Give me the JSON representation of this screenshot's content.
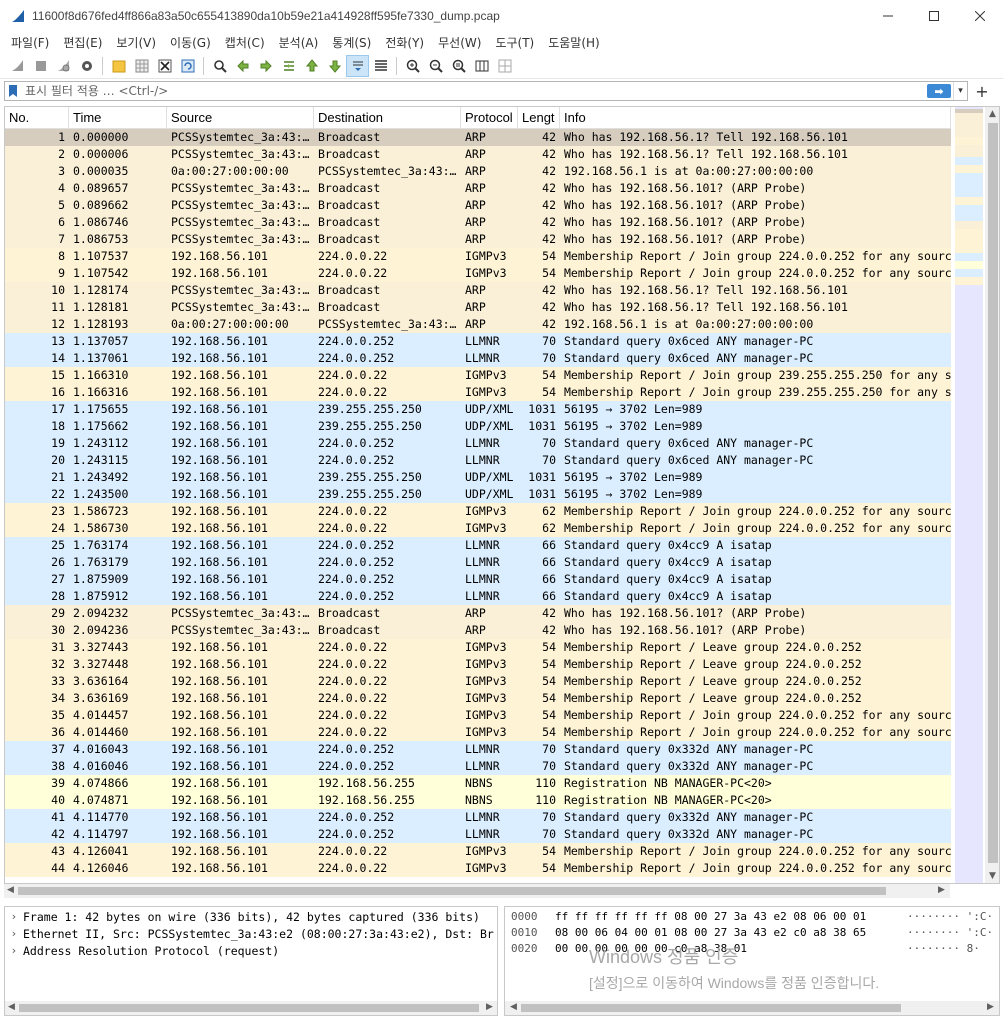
{
  "window": {
    "title": "11600f8d676fed4ff866a83a50c655413890da10b59e21a414928ff595fe7330_dump.pcap",
    "minimize": "—",
    "maximize": "☐",
    "close": "✕"
  },
  "menu": [
    "파일(F)",
    "편집(E)",
    "보기(V)",
    "이동(G)",
    "캡처(C)",
    "분석(A)",
    "통계(S)",
    "전화(Y)",
    "무선(W)",
    "도구(T)",
    "도움말(H)"
  ],
  "filter": {
    "placeholder": "표시 필터 적용 … <Ctrl-/>",
    "apply": "➡",
    "dropdown": "▾",
    "add": "+"
  },
  "columns": [
    "No.",
    "Time",
    "Source",
    "Destination",
    "Protocol",
    "Lengt",
    "Info"
  ],
  "colors": {
    "arp": "#faf0d7",
    "igmp": "#fff3d6",
    "udp": "#daeeff",
    "nbns": "#ffffda",
    "selected": "#d6cdbf"
  },
  "packets": [
    {
      "no": "1",
      "time": "0.000000",
      "src": "PCSSystemtec_3a:43:…",
      "dst": "Broadcast",
      "proto": "ARP",
      "len": "42",
      "info": "Who has 192.168.56.1? Tell 192.168.56.101",
      "kind": "arp",
      "selected": true
    },
    {
      "no": "2",
      "time": "0.000006",
      "src": "PCSSystemtec_3a:43:…",
      "dst": "Broadcast",
      "proto": "ARP",
      "len": "42",
      "info": "Who has 192.168.56.1? Tell 192.168.56.101",
      "kind": "arp"
    },
    {
      "no": "3",
      "time": "0.000035",
      "src": "0a:00:27:00:00:00",
      "dst": "PCSSystemtec_3a:43:…",
      "proto": "ARP",
      "len": "42",
      "info": "192.168.56.1 is at 0a:00:27:00:00:00",
      "kind": "arp"
    },
    {
      "no": "4",
      "time": "0.089657",
      "src": "PCSSystemtec_3a:43:…",
      "dst": "Broadcast",
      "proto": "ARP",
      "len": "42",
      "info": "Who has 192.168.56.101? (ARP Probe)",
      "kind": "arp"
    },
    {
      "no": "5",
      "time": "0.089662",
      "src": "PCSSystemtec_3a:43:…",
      "dst": "Broadcast",
      "proto": "ARP",
      "len": "42",
      "info": "Who has 192.168.56.101? (ARP Probe)",
      "kind": "arp"
    },
    {
      "no": "6",
      "time": "1.086746",
      "src": "PCSSystemtec_3a:43:…",
      "dst": "Broadcast",
      "proto": "ARP",
      "len": "42",
      "info": "Who has 192.168.56.101? (ARP Probe)",
      "kind": "arp"
    },
    {
      "no": "7",
      "time": "1.086753",
      "src": "PCSSystemtec_3a:43:…",
      "dst": "Broadcast",
      "proto": "ARP",
      "len": "42",
      "info": "Who has 192.168.56.101? (ARP Probe)",
      "kind": "arp"
    },
    {
      "no": "8",
      "time": "1.107537",
      "src": "192.168.56.101",
      "dst": "224.0.0.22",
      "proto": "IGMPv3",
      "len": "54",
      "info": "Membership Report / Join group 224.0.0.252 for any sourc",
      "kind": "igmp"
    },
    {
      "no": "9",
      "time": "1.107542",
      "src": "192.168.56.101",
      "dst": "224.0.0.22",
      "proto": "IGMPv3",
      "len": "54",
      "info": "Membership Report / Join group 224.0.0.252 for any sourc",
      "kind": "igmp"
    },
    {
      "no": "10",
      "time": "1.128174",
      "src": "PCSSystemtec_3a:43:…",
      "dst": "Broadcast",
      "proto": "ARP",
      "len": "42",
      "info": "Who has 192.168.56.1? Tell 192.168.56.101",
      "kind": "arp"
    },
    {
      "no": "11",
      "time": "1.128181",
      "src": "PCSSystemtec_3a:43:…",
      "dst": "Broadcast",
      "proto": "ARP",
      "len": "42",
      "info": "Who has 192.168.56.1? Tell 192.168.56.101",
      "kind": "arp"
    },
    {
      "no": "12",
      "time": "1.128193",
      "src": "0a:00:27:00:00:00",
      "dst": "PCSSystemtec_3a:43:…",
      "proto": "ARP",
      "len": "42",
      "info": "192.168.56.1 is at 0a:00:27:00:00:00",
      "kind": "arp"
    },
    {
      "no": "13",
      "time": "1.137057",
      "src": "192.168.56.101",
      "dst": "224.0.0.252",
      "proto": "LLMNR",
      "len": "70",
      "info": "Standard query 0x6ced ANY manager-PC",
      "kind": "udp"
    },
    {
      "no": "14",
      "time": "1.137061",
      "src": "192.168.56.101",
      "dst": "224.0.0.252",
      "proto": "LLMNR",
      "len": "70",
      "info": "Standard query 0x6ced ANY manager-PC",
      "kind": "udp"
    },
    {
      "no": "15",
      "time": "1.166310",
      "src": "192.168.56.101",
      "dst": "224.0.0.22",
      "proto": "IGMPv3",
      "len": "54",
      "info": "Membership Report / Join group 239.255.255.250 for any s",
      "kind": "igmp"
    },
    {
      "no": "16",
      "time": "1.166316",
      "src": "192.168.56.101",
      "dst": "224.0.0.22",
      "proto": "IGMPv3",
      "len": "54",
      "info": "Membership Report / Join group 239.255.255.250 for any s",
      "kind": "igmp"
    },
    {
      "no": "17",
      "time": "1.175655",
      "src": "192.168.56.101",
      "dst": "239.255.255.250",
      "proto": "UDP/XML",
      "len": "1031",
      "info": "56195 → 3702 Len=989",
      "kind": "udp"
    },
    {
      "no": "18",
      "time": "1.175662",
      "src": "192.168.56.101",
      "dst": "239.255.255.250",
      "proto": "UDP/XML",
      "len": "1031",
      "info": "56195 → 3702 Len=989",
      "kind": "udp"
    },
    {
      "no": "19",
      "time": "1.243112",
      "src": "192.168.56.101",
      "dst": "224.0.0.252",
      "proto": "LLMNR",
      "len": "70",
      "info": "Standard query 0x6ced ANY manager-PC",
      "kind": "udp"
    },
    {
      "no": "20",
      "time": "1.243115",
      "src": "192.168.56.101",
      "dst": "224.0.0.252",
      "proto": "LLMNR",
      "len": "70",
      "info": "Standard query 0x6ced ANY manager-PC",
      "kind": "udp"
    },
    {
      "no": "21",
      "time": "1.243492",
      "src": "192.168.56.101",
      "dst": "239.255.255.250",
      "proto": "UDP/XML",
      "len": "1031",
      "info": "56195 → 3702 Len=989",
      "kind": "udp"
    },
    {
      "no": "22",
      "time": "1.243500",
      "src": "192.168.56.101",
      "dst": "239.255.255.250",
      "proto": "UDP/XML",
      "len": "1031",
      "info": "56195 → 3702 Len=989",
      "kind": "udp"
    },
    {
      "no": "23",
      "time": "1.586723",
      "src": "192.168.56.101",
      "dst": "224.0.0.22",
      "proto": "IGMPv3",
      "len": "62",
      "info": "Membership Report / Join group 224.0.0.252 for any sourc",
      "kind": "igmp"
    },
    {
      "no": "24",
      "time": "1.586730",
      "src": "192.168.56.101",
      "dst": "224.0.0.22",
      "proto": "IGMPv3",
      "len": "62",
      "info": "Membership Report / Join group 224.0.0.252 for any sourc",
      "kind": "igmp"
    },
    {
      "no": "25",
      "time": "1.763174",
      "src": "192.168.56.101",
      "dst": "224.0.0.252",
      "proto": "LLMNR",
      "len": "66",
      "info": "Standard query 0x4cc9 A isatap",
      "kind": "udp"
    },
    {
      "no": "26",
      "time": "1.763179",
      "src": "192.168.56.101",
      "dst": "224.0.0.252",
      "proto": "LLMNR",
      "len": "66",
      "info": "Standard query 0x4cc9 A isatap",
      "kind": "udp"
    },
    {
      "no": "27",
      "time": "1.875909",
      "src": "192.168.56.101",
      "dst": "224.0.0.252",
      "proto": "LLMNR",
      "len": "66",
      "info": "Standard query 0x4cc9 A isatap",
      "kind": "udp"
    },
    {
      "no": "28",
      "time": "1.875912",
      "src": "192.168.56.101",
      "dst": "224.0.0.252",
      "proto": "LLMNR",
      "len": "66",
      "info": "Standard query 0x4cc9 A isatap",
      "kind": "udp"
    },
    {
      "no": "29",
      "time": "2.094232",
      "src": "PCSSystemtec_3a:43:…",
      "dst": "Broadcast",
      "proto": "ARP",
      "len": "42",
      "info": "Who has 192.168.56.101? (ARP Probe)",
      "kind": "arp"
    },
    {
      "no": "30",
      "time": "2.094236",
      "src": "PCSSystemtec_3a:43:…",
      "dst": "Broadcast",
      "proto": "ARP",
      "len": "42",
      "info": "Who has 192.168.56.101? (ARP Probe)",
      "kind": "arp"
    },
    {
      "no": "31",
      "time": "3.327443",
      "src": "192.168.56.101",
      "dst": "224.0.0.22",
      "proto": "IGMPv3",
      "len": "54",
      "info": "Membership Report / Leave group 224.0.0.252",
      "kind": "igmp"
    },
    {
      "no": "32",
      "time": "3.327448",
      "src": "192.168.56.101",
      "dst": "224.0.0.22",
      "proto": "IGMPv3",
      "len": "54",
      "info": "Membership Report / Leave group 224.0.0.252",
      "kind": "igmp"
    },
    {
      "no": "33",
      "time": "3.636164",
      "src": "192.168.56.101",
      "dst": "224.0.0.22",
      "proto": "IGMPv3",
      "len": "54",
      "info": "Membership Report / Leave group 224.0.0.252",
      "kind": "igmp"
    },
    {
      "no": "34",
      "time": "3.636169",
      "src": "192.168.56.101",
      "dst": "224.0.0.22",
      "proto": "IGMPv3",
      "len": "54",
      "info": "Membership Report / Leave group 224.0.0.252",
      "kind": "igmp"
    },
    {
      "no": "35",
      "time": "4.014457",
      "src": "192.168.56.101",
      "dst": "224.0.0.22",
      "proto": "IGMPv3",
      "len": "54",
      "info": "Membership Report / Join group 224.0.0.252 for any sourc",
      "kind": "igmp"
    },
    {
      "no": "36",
      "time": "4.014460",
      "src": "192.168.56.101",
      "dst": "224.0.0.22",
      "proto": "IGMPv3",
      "len": "54",
      "info": "Membership Report / Join group 224.0.0.252 for any sourc",
      "kind": "igmp"
    },
    {
      "no": "37",
      "time": "4.016043",
      "src": "192.168.56.101",
      "dst": "224.0.0.252",
      "proto": "LLMNR",
      "len": "70",
      "info": "Standard query 0x332d ANY manager-PC",
      "kind": "udp"
    },
    {
      "no": "38",
      "time": "4.016046",
      "src": "192.168.56.101",
      "dst": "224.0.0.252",
      "proto": "LLMNR",
      "len": "70",
      "info": "Standard query 0x332d ANY manager-PC",
      "kind": "udp"
    },
    {
      "no": "39",
      "time": "4.074866",
      "src": "192.168.56.101",
      "dst": "192.168.56.255",
      "proto": "NBNS",
      "len": "110",
      "info": "Registration NB MANAGER-PC<20>",
      "kind": "nbns"
    },
    {
      "no": "40",
      "time": "4.074871",
      "src": "192.168.56.101",
      "dst": "192.168.56.255",
      "proto": "NBNS",
      "len": "110",
      "info": "Registration NB MANAGER-PC<20>",
      "kind": "nbns"
    },
    {
      "no": "41",
      "time": "4.114770",
      "src": "192.168.56.101",
      "dst": "224.0.0.252",
      "proto": "LLMNR",
      "len": "70",
      "info": "Standard query 0x332d ANY manager-PC",
      "kind": "udp"
    },
    {
      "no": "42",
      "time": "4.114797",
      "src": "192.168.56.101",
      "dst": "224.0.0.252",
      "proto": "LLMNR",
      "len": "70",
      "info": "Standard query 0x332d ANY manager-PC",
      "kind": "udp"
    },
    {
      "no": "43",
      "time": "4.126041",
      "src": "192.168.56.101",
      "dst": "224.0.0.22",
      "proto": "IGMPv3",
      "len": "54",
      "info": "Membership Report / Join group 224.0.0.252 for any sourc",
      "kind": "igmp"
    },
    {
      "no": "44",
      "time": "4.126046",
      "src": "192.168.56.101",
      "dst": "224.0.0.22",
      "proto": "IGMPv3",
      "len": "54",
      "info": "Membership Report / Join group 224.0.0.252 for any sourc",
      "kind": "igmp"
    }
  ],
  "details": [
    {
      "chevron": "›",
      "text": "Frame 1: 42 bytes on wire (336 bits), 42 bytes captured (336 bits)"
    },
    {
      "chevron": "›",
      "text": "Ethernet II, Src: PCSSystemtec_3a:43:e2 (08:00:27:3a:43:e2), Dst: Br"
    },
    {
      "chevron": "›",
      "text": "Address Resolution Protocol (request)"
    }
  ],
  "bytes": [
    {
      "offset": "0000",
      "hex": "ff ff ff ff ff ff 08 00  27 3a 43 e2 08 06 00 01",
      "ascii": "········ ':C·"
    },
    {
      "offset": "0010",
      "hex": "08 00 06 04 00 01 08 00  27 3a 43 e2 c0 a8 38 65",
      "ascii": "········ ':C·"
    },
    {
      "offset": "0020",
      "hex": "00 00 00 00 00 00 c0 a8  38 01",
      "ascii": "········ 8·"
    }
  ],
  "watermark": {
    "line1": "Windows 정품 인증",
    "line2": "[설정]으로 이동하여 Windows를 정품 인증합니다."
  }
}
